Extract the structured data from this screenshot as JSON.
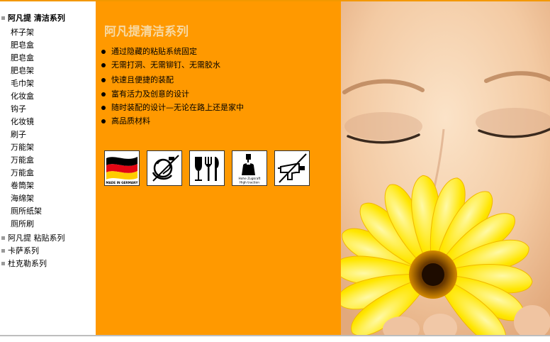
{
  "nav": {
    "categories": [
      {
        "label": "阿凡提  清洁系列",
        "active": true
      },
      {
        "label": "阿凡提  粘贴系列"
      },
      {
        "label": "卡萨系列"
      },
      {
        "label": "杜克勒系列"
      }
    ],
    "items": [
      "杯子架",
      "肥皂盒",
      "肥皂盒",
      "肥皂架",
      "毛巾架",
      "化妆盒",
      "钩子",
      "化妆镜",
      "刷子",
      "万能架",
      "万能盒",
      "万能盒",
      "卷筒架",
      "海绵架",
      "厕所纸架",
      "厕所刷"
    ]
  },
  "main": {
    "title": "阿凡提清洁系列",
    "features": [
      "通过隐藏的粘贴系统固定",
      "无需打洞、无需铆钉、无需胶水",
      "快速且便捷的装配",
      "富有活力及创意的设计",
      "随时装配的设计—无论在路上还是家中",
      "高品质材料"
    ]
  },
  "icons": [
    {
      "name": "made-in-germany-flag-icon",
      "caption": "MADE IN GERMANY"
    },
    {
      "name": "no-drilling-icon"
    },
    {
      "name": "food-safe-icon"
    },
    {
      "name": "high-traction-icon",
      "caption_1": "Hohe Zugkraft",
      "caption_2": "High traction"
    },
    {
      "name": "no-drill-icon"
    }
  ],
  "colors": {
    "orange": "#ff9900",
    "title": "#f7d9a3",
    "flower": "#ffe600"
  }
}
